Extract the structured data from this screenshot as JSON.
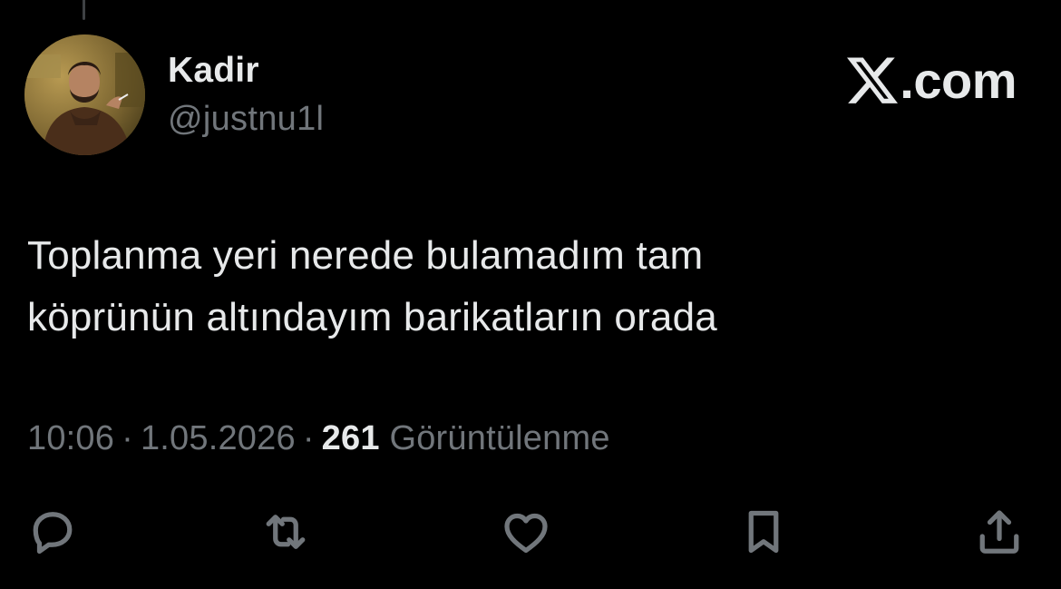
{
  "user": {
    "display_name": "Kadir",
    "handle": "@justnu1l",
    "avatar": "avatar-photo"
  },
  "brand": {
    "label": ".com",
    "icon": "x-logo-icon"
  },
  "tweet": {
    "lines": [
      "Toplanma yeri nerede bulamadım tam",
      "köprünün altındayım barikatların orada"
    ]
  },
  "meta": {
    "time": "10:06",
    "separator": "·",
    "date": "1.05.2026",
    "views_count": "261",
    "views_label": "Görüntülenme"
  },
  "actions": [
    {
      "name": "reply",
      "icon": "reply-icon"
    },
    {
      "name": "retweet",
      "icon": "retweet-icon"
    },
    {
      "name": "like",
      "icon": "heart-icon"
    },
    {
      "name": "bookmark",
      "icon": "bookmark-icon"
    },
    {
      "name": "share",
      "icon": "share-icon"
    }
  ],
  "colors": {
    "background": "#000000",
    "primary_text": "#e7e9ea",
    "secondary_text": "#71767b"
  }
}
